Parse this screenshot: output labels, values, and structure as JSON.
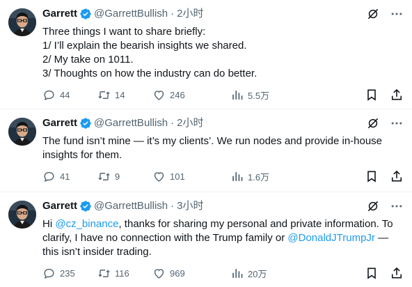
{
  "tweets": [
    {
      "name": "Garrett",
      "handle": "@GarrettBullish",
      "dot": "·",
      "time": "2小时",
      "lines": [
        "Three things I want to share briefly:",
        "1/ I’ll explain the bearish insights we shared.",
        "2/ My take on 1011.",
        "3/ Thoughts on how the industry can do better."
      ],
      "replies": "44",
      "retweets": "14",
      "likes": "246",
      "views": "5.5万"
    },
    {
      "name": "Garrett",
      "handle": "@GarrettBullish",
      "dot": "·",
      "time": "2小时",
      "lines": [
        "The fund isn’t mine — it’s my clients’. We run nodes and provide in-house",
        "insights for them."
      ],
      "replies": "41",
      "retweets": "9",
      "likes": "101",
      "views": "1.6万"
    },
    {
      "name": "Garrett",
      "handle": "@GarrettBullish",
      "dot": "·",
      "time": "3小时",
      "text_a": "Hi ",
      "mention1": "@cz_binance",
      "text_b": ", thanks for sharing my personal and private information. To clarify, I have no connection with the Trump family or ",
      "mention2": "@DonaldJTrumpJr",
      "text_c": " — this isn’t insider trading.",
      "replies": "235",
      "retweets": "116",
      "likes": "969",
      "views": "20万"
    }
  ],
  "icons": {
    "verified": "verified-badge-icon",
    "grok": "grok-icon",
    "more": "more-icon",
    "reply": "reply-icon",
    "retweet": "retweet-icon",
    "like": "like-icon",
    "views": "views-icon",
    "bookmark": "bookmark-icon",
    "share": "share-icon"
  },
  "colors": {
    "link": "#1d9bf0",
    "verified": "#1d9bf0",
    "muted": "#536471",
    "text": "#0f1419"
  }
}
